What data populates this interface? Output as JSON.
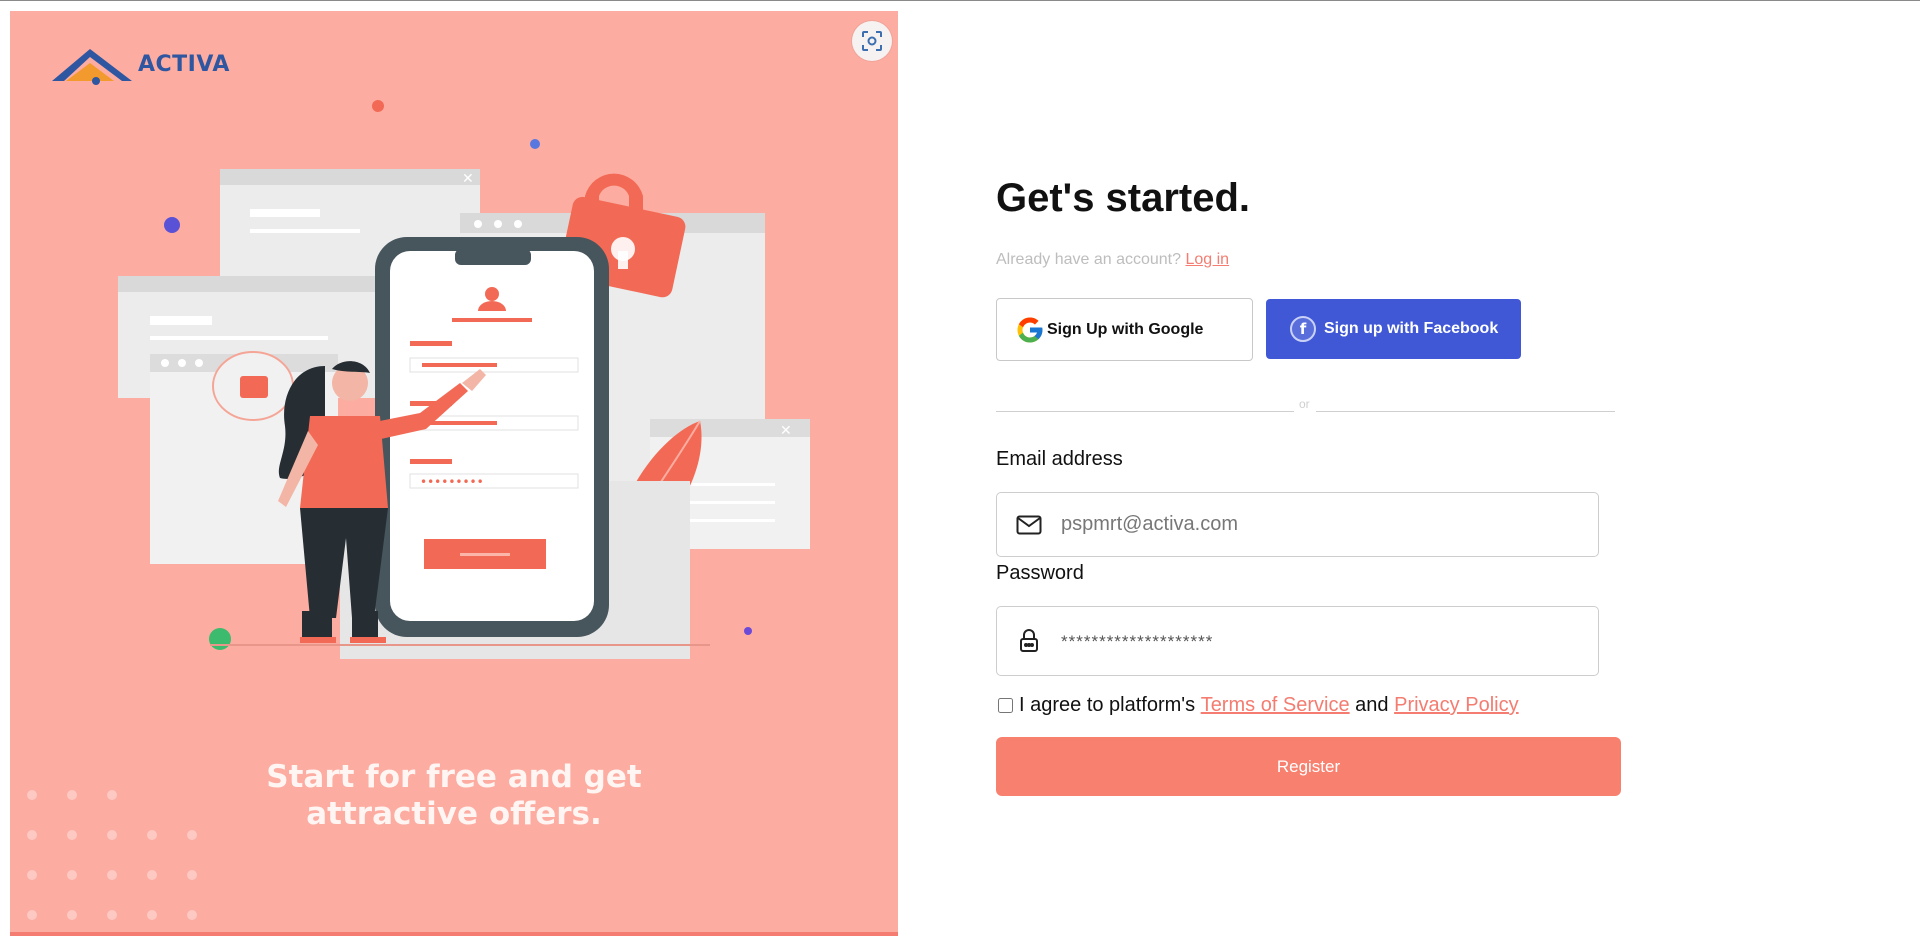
{
  "brand": {
    "name": "ACTIVA"
  },
  "hero": {
    "caption_line1": "Start for free and get",
    "caption_line2": "attractive offers."
  },
  "form": {
    "title": "Get's started.",
    "login_prompt": "Already have an account?",
    "login_link": "Log in",
    "google_label": "Sign Up with Google",
    "facebook_label": "Sign up with Facebook",
    "divider_text": "or",
    "email": {
      "label": "Email address",
      "placeholder": "pspmrt@activa.com"
    },
    "password": {
      "label": "Password",
      "placeholder": "********************"
    },
    "terms": {
      "prefix": "I agree to platform's ",
      "terms_link": "Terms of Service",
      "and": " and ",
      "privacy_link": "Privacy Policy"
    },
    "register_label": "Register"
  },
  "colors": {
    "accent": "#f47c70",
    "hero_background": "#fdaca1",
    "facebook": "#4058d5",
    "register": "#f8806f",
    "logo_blue": "#2f56a0"
  },
  "icons": [
    "activa-logo-icon",
    "scan-icon",
    "google-icon",
    "facebook-icon",
    "mail-icon",
    "lock-icon"
  ]
}
